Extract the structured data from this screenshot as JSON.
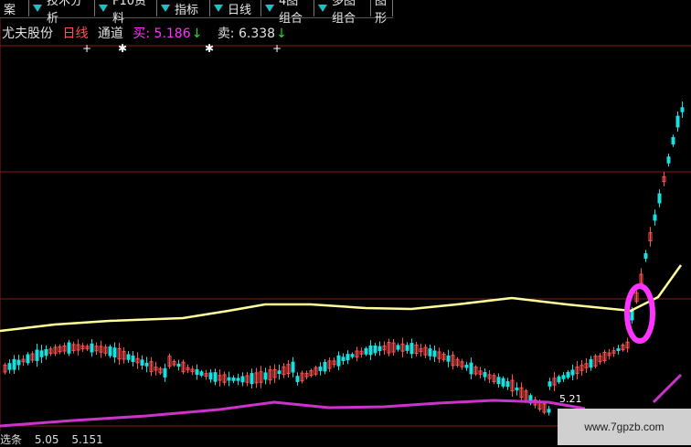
{
  "tabs": [
    {
      "label": "案",
      "arrow": false
    },
    {
      "label": "技术分析",
      "arrow": true
    },
    {
      "label": "F10资料",
      "arrow": true
    },
    {
      "label": "指标",
      "arrow": true
    },
    {
      "label": "日线",
      "arrow": true
    },
    {
      "label": "4图组合",
      "arrow": true
    },
    {
      "label": "多图组合",
      "arrow": true
    },
    {
      "label": "图形",
      "arrow": false
    }
  ],
  "info": {
    "stock_name": "尤夫股份",
    "period": "日线",
    "indicator": "通道",
    "buy_label": "买:",
    "buy_value": "5.186",
    "sell_label": "卖:",
    "sell_value": "6.338"
  },
  "colors": {
    "up_candle": "#ff5050",
    "down_candle": "#19e0e0",
    "upper_line": "#ffff99",
    "lower_line": "#cc33cc",
    "highlight_circle": "#ff33ff",
    "grid": "#8b1a1a"
  },
  "chart_data": {
    "type": "candlestick",
    "series": [
      {
        "name": "通道",
        "values": []
      }
    ],
    "price_annotation": "5.21"
  },
  "bottom": {
    "label": "选条",
    "value1": "5.05",
    "value2": "5.151"
  },
  "watermark": "www.7gpzb.com"
}
